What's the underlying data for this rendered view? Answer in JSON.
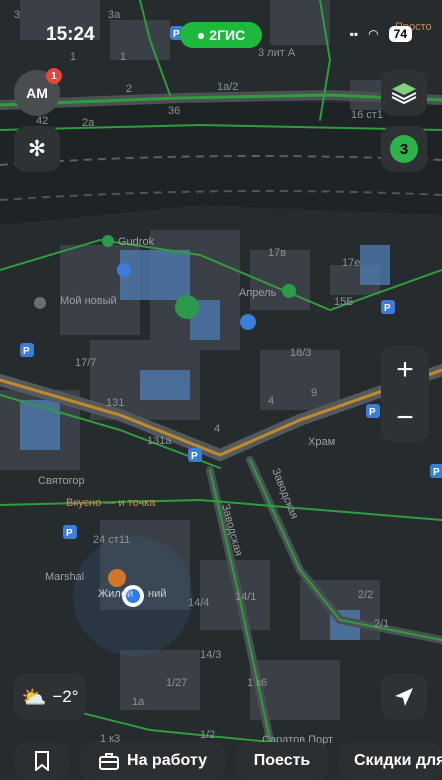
{
  "status": {
    "time": "15:24",
    "battery": "74"
  },
  "brand": {
    "label": "2ГИС"
  },
  "avatar": {
    "initials": "АМ",
    "badge": "1"
  },
  "layers": {
    "count": "3"
  },
  "weather": {
    "temperature": "−2°"
  },
  "map": {
    "labels": {
      "a3": "3а",
      "a3b": "3",
      "a1": "1",
      "a1b": "1",
      "a2": "2",
      "a36": "36",
      "a1a2": "1а/2",
      "a3litA": "3 лит А",
      "a16st1": "16 ст1",
      "a42": "42",
      "a2a": "2а",
      "prosto": "Просто",
      "gudrok": "Gudrok",
      "moynovy": "Мой новый",
      "aprel": "Апрель",
      "a17v": "17в",
      "a17e": "17е",
      "a15b": "15Б",
      "a17_7": "17/7",
      "a131": "131",
      "a131a": "131а",
      "a18_3": "18/3",
      "a9": "9",
      "a4": "4",
      "a4b": "4",
      "khram": "Храм",
      "bi": "Би",
      "svyatogor": "Святогор",
      "vkusno": "Вкусно — и точка",
      "a24st11": "24 ст11",
      "marshal": "Marshal",
      "zhiloy": "Жилой",
      "zhiloy2": "ний",
      "a14_4": "14/4",
      "a14_1": "14/1",
      "a14_3": "14/3",
      "a1_27": "1/27",
      "a1k6": "1 к6",
      "a1k3": "1 к3",
      "a1a": "1а",
      "a1_2": "1/2",
      "a2_2": "2/2",
      "a2_1": "2/1",
      "zavodskaya": "Заводская",
      "zavodskaya2": "Заводская",
      "saratov": "Саратов Порт"
    }
  },
  "bottom": {
    "work": "На работу",
    "eat": "Поесть",
    "discounts": "Скидки для"
  }
}
